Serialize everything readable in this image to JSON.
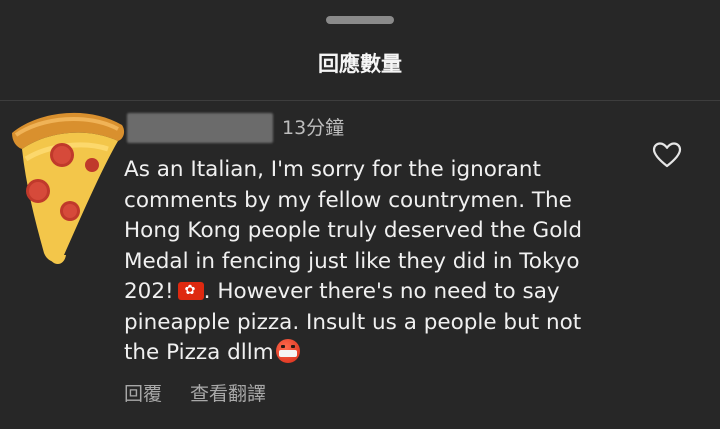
{
  "sheet": {
    "title": "回應數量"
  },
  "comment": {
    "avatar": "pizza-slice-avatar",
    "timestamp": "13分鐘",
    "lines": [
      "As an Italian, I'm sorry for the ignorant",
      "comments by my fellow countrymen. The",
      "Hong Kong people truly deserved the Gold",
      "Medal in fencing just like they did in Tokyo",
      "202!",
      ". However there's no need to say",
      "pineapple pizza. Insult us a people but not",
      "the Pizza dllm"
    ],
    "actions": {
      "reply": "回覆",
      "translate": "查看翻譯"
    },
    "like_icon": "heart-outline-icon"
  }
}
